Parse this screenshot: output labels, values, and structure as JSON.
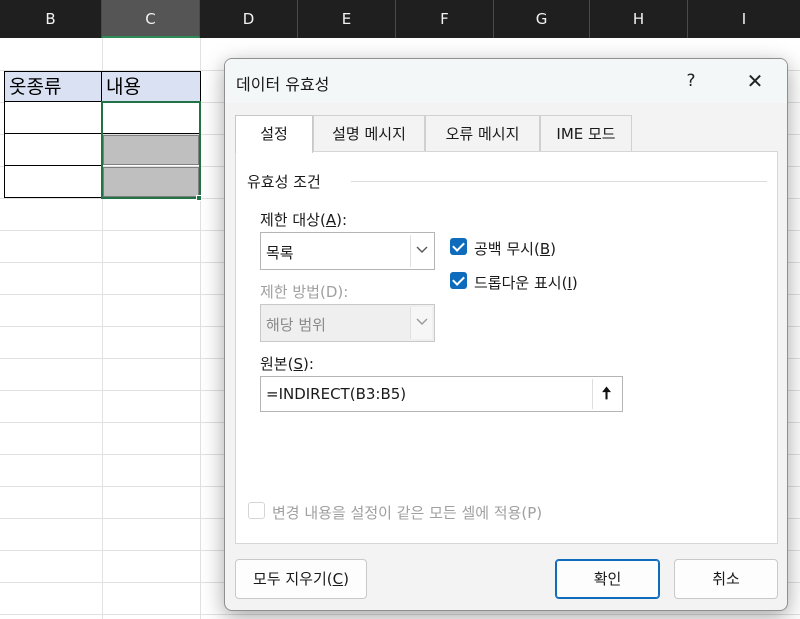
{
  "sheet": {
    "columns": [
      "B",
      "C",
      "D",
      "E",
      "F",
      "G",
      "H",
      "I"
    ],
    "selected_column": "C",
    "cells": {
      "b2": "옷종류",
      "c2": "내용"
    }
  },
  "dialog": {
    "title": "데이터 유효성",
    "help": "?",
    "close": "✕",
    "tabs": [
      {
        "label": "설정",
        "active": true
      },
      {
        "label": "설명 메시지",
        "active": false
      },
      {
        "label": "오류 메시지",
        "active": false
      },
      {
        "label": "IME 모드",
        "active": false
      }
    ],
    "criteria_group": "유효성 조건",
    "allow": {
      "label": "제한 대상(",
      "key": "A",
      "suffix": "):",
      "value": "목록"
    },
    "data": {
      "label": "제한 방법(D):",
      "value": "해당 범위"
    },
    "ignore_blank": {
      "label": "공백 무시(",
      "key": "B",
      "suffix": ")",
      "checked": true
    },
    "in_cell_dropdown": {
      "label": "드롭다운 표시(",
      "key": "I",
      "suffix": ")",
      "checked": true
    },
    "source": {
      "label": "원본(",
      "key": "S",
      "suffix": "):",
      "value": "=INDIRECT(B3:B5)",
      "button_icon": "🠅"
    },
    "apply_all": {
      "label": "변경 내용을 설정이 같은 모든 셀에 적용(P)",
      "checked": false
    },
    "clear_all": {
      "label": "모두 지우기(",
      "key": "C",
      "suffix": ")"
    },
    "ok": "확인",
    "cancel": "취소"
  }
}
